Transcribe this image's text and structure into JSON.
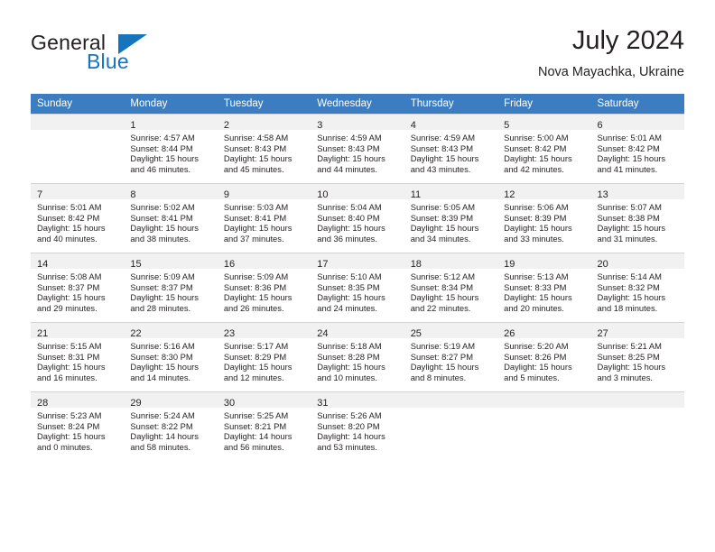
{
  "brand": {
    "name_part1": "General",
    "name_part2": "Blue",
    "logo_icon": "triangle-flag-icon",
    "accent_color": "#1574bb"
  },
  "header": {
    "title": "July 2024",
    "subtitle": "Nova Mayachka, Ukraine"
  },
  "calendar": {
    "header_bg": "#3b7dc0",
    "daynum_band_bg": "#f1f1f1",
    "weekday_headers": [
      "Sunday",
      "Monday",
      "Tuesday",
      "Wednesday",
      "Thursday",
      "Friday",
      "Saturday"
    ],
    "weeks": [
      [
        {
          "day": "",
          "sunrise": "",
          "sunset": "",
          "daylight_line1": "",
          "daylight_line2": ""
        },
        {
          "day": "1",
          "sunrise": "Sunrise: 4:57 AM",
          "sunset": "Sunset: 8:44 PM",
          "daylight_line1": "Daylight: 15 hours",
          "daylight_line2": "and 46 minutes."
        },
        {
          "day": "2",
          "sunrise": "Sunrise: 4:58 AM",
          "sunset": "Sunset: 8:43 PM",
          "daylight_line1": "Daylight: 15 hours",
          "daylight_line2": "and 45 minutes."
        },
        {
          "day": "3",
          "sunrise": "Sunrise: 4:59 AM",
          "sunset": "Sunset: 8:43 PM",
          "daylight_line1": "Daylight: 15 hours",
          "daylight_line2": "and 44 minutes."
        },
        {
          "day": "4",
          "sunrise": "Sunrise: 4:59 AM",
          "sunset": "Sunset: 8:43 PM",
          "daylight_line1": "Daylight: 15 hours",
          "daylight_line2": "and 43 minutes."
        },
        {
          "day": "5",
          "sunrise": "Sunrise: 5:00 AM",
          "sunset": "Sunset: 8:42 PM",
          "daylight_line1": "Daylight: 15 hours",
          "daylight_line2": "and 42 minutes."
        },
        {
          "day": "6",
          "sunrise": "Sunrise: 5:01 AM",
          "sunset": "Sunset: 8:42 PM",
          "daylight_line1": "Daylight: 15 hours",
          "daylight_line2": "and 41 minutes."
        }
      ],
      [
        {
          "day": "7",
          "sunrise": "Sunrise: 5:01 AM",
          "sunset": "Sunset: 8:42 PM",
          "daylight_line1": "Daylight: 15 hours",
          "daylight_line2": "and 40 minutes."
        },
        {
          "day": "8",
          "sunrise": "Sunrise: 5:02 AM",
          "sunset": "Sunset: 8:41 PM",
          "daylight_line1": "Daylight: 15 hours",
          "daylight_line2": "and 38 minutes."
        },
        {
          "day": "9",
          "sunrise": "Sunrise: 5:03 AM",
          "sunset": "Sunset: 8:41 PM",
          "daylight_line1": "Daylight: 15 hours",
          "daylight_line2": "and 37 minutes."
        },
        {
          "day": "10",
          "sunrise": "Sunrise: 5:04 AM",
          "sunset": "Sunset: 8:40 PM",
          "daylight_line1": "Daylight: 15 hours",
          "daylight_line2": "and 36 minutes."
        },
        {
          "day": "11",
          "sunrise": "Sunrise: 5:05 AM",
          "sunset": "Sunset: 8:39 PM",
          "daylight_line1": "Daylight: 15 hours",
          "daylight_line2": "and 34 minutes."
        },
        {
          "day": "12",
          "sunrise": "Sunrise: 5:06 AM",
          "sunset": "Sunset: 8:39 PM",
          "daylight_line1": "Daylight: 15 hours",
          "daylight_line2": "and 33 minutes."
        },
        {
          "day": "13",
          "sunrise": "Sunrise: 5:07 AM",
          "sunset": "Sunset: 8:38 PM",
          "daylight_line1": "Daylight: 15 hours",
          "daylight_line2": "and 31 minutes."
        }
      ],
      [
        {
          "day": "14",
          "sunrise": "Sunrise: 5:08 AM",
          "sunset": "Sunset: 8:37 PM",
          "daylight_line1": "Daylight: 15 hours",
          "daylight_line2": "and 29 minutes."
        },
        {
          "day": "15",
          "sunrise": "Sunrise: 5:09 AM",
          "sunset": "Sunset: 8:37 PM",
          "daylight_line1": "Daylight: 15 hours",
          "daylight_line2": "and 28 minutes."
        },
        {
          "day": "16",
          "sunrise": "Sunrise: 5:09 AM",
          "sunset": "Sunset: 8:36 PM",
          "daylight_line1": "Daylight: 15 hours",
          "daylight_line2": "and 26 minutes."
        },
        {
          "day": "17",
          "sunrise": "Sunrise: 5:10 AM",
          "sunset": "Sunset: 8:35 PM",
          "daylight_line1": "Daylight: 15 hours",
          "daylight_line2": "and 24 minutes."
        },
        {
          "day": "18",
          "sunrise": "Sunrise: 5:12 AM",
          "sunset": "Sunset: 8:34 PM",
          "daylight_line1": "Daylight: 15 hours",
          "daylight_line2": "and 22 minutes."
        },
        {
          "day": "19",
          "sunrise": "Sunrise: 5:13 AM",
          "sunset": "Sunset: 8:33 PM",
          "daylight_line1": "Daylight: 15 hours",
          "daylight_line2": "and 20 minutes."
        },
        {
          "day": "20",
          "sunrise": "Sunrise: 5:14 AM",
          "sunset": "Sunset: 8:32 PM",
          "daylight_line1": "Daylight: 15 hours",
          "daylight_line2": "and 18 minutes."
        }
      ],
      [
        {
          "day": "21",
          "sunrise": "Sunrise: 5:15 AM",
          "sunset": "Sunset: 8:31 PM",
          "daylight_line1": "Daylight: 15 hours",
          "daylight_line2": "and 16 minutes."
        },
        {
          "day": "22",
          "sunrise": "Sunrise: 5:16 AM",
          "sunset": "Sunset: 8:30 PM",
          "daylight_line1": "Daylight: 15 hours",
          "daylight_line2": "and 14 minutes."
        },
        {
          "day": "23",
          "sunrise": "Sunrise: 5:17 AM",
          "sunset": "Sunset: 8:29 PM",
          "daylight_line1": "Daylight: 15 hours",
          "daylight_line2": "and 12 minutes."
        },
        {
          "day": "24",
          "sunrise": "Sunrise: 5:18 AM",
          "sunset": "Sunset: 8:28 PM",
          "daylight_line1": "Daylight: 15 hours",
          "daylight_line2": "and 10 minutes."
        },
        {
          "day": "25",
          "sunrise": "Sunrise: 5:19 AM",
          "sunset": "Sunset: 8:27 PM",
          "daylight_line1": "Daylight: 15 hours",
          "daylight_line2": "and 8 minutes."
        },
        {
          "day": "26",
          "sunrise": "Sunrise: 5:20 AM",
          "sunset": "Sunset: 8:26 PM",
          "daylight_line1": "Daylight: 15 hours",
          "daylight_line2": "and 5 minutes."
        },
        {
          "day": "27",
          "sunrise": "Sunrise: 5:21 AM",
          "sunset": "Sunset: 8:25 PM",
          "daylight_line1": "Daylight: 15 hours",
          "daylight_line2": "and 3 minutes."
        }
      ],
      [
        {
          "day": "28",
          "sunrise": "Sunrise: 5:23 AM",
          "sunset": "Sunset: 8:24 PM",
          "daylight_line1": "Daylight: 15 hours",
          "daylight_line2": "and 0 minutes."
        },
        {
          "day": "29",
          "sunrise": "Sunrise: 5:24 AM",
          "sunset": "Sunset: 8:22 PM",
          "daylight_line1": "Daylight: 14 hours",
          "daylight_line2": "and 58 minutes."
        },
        {
          "day": "30",
          "sunrise": "Sunrise: 5:25 AM",
          "sunset": "Sunset: 8:21 PM",
          "daylight_line1": "Daylight: 14 hours",
          "daylight_line2": "and 56 minutes."
        },
        {
          "day": "31",
          "sunrise": "Sunrise: 5:26 AM",
          "sunset": "Sunset: 8:20 PM",
          "daylight_line1": "Daylight: 14 hours",
          "daylight_line2": "and 53 minutes."
        },
        {
          "day": "",
          "sunrise": "",
          "sunset": "",
          "daylight_line1": "",
          "daylight_line2": ""
        },
        {
          "day": "",
          "sunrise": "",
          "sunset": "",
          "daylight_line1": "",
          "daylight_line2": ""
        },
        {
          "day": "",
          "sunrise": "",
          "sunset": "",
          "daylight_line1": "",
          "daylight_line2": ""
        }
      ]
    ]
  }
}
